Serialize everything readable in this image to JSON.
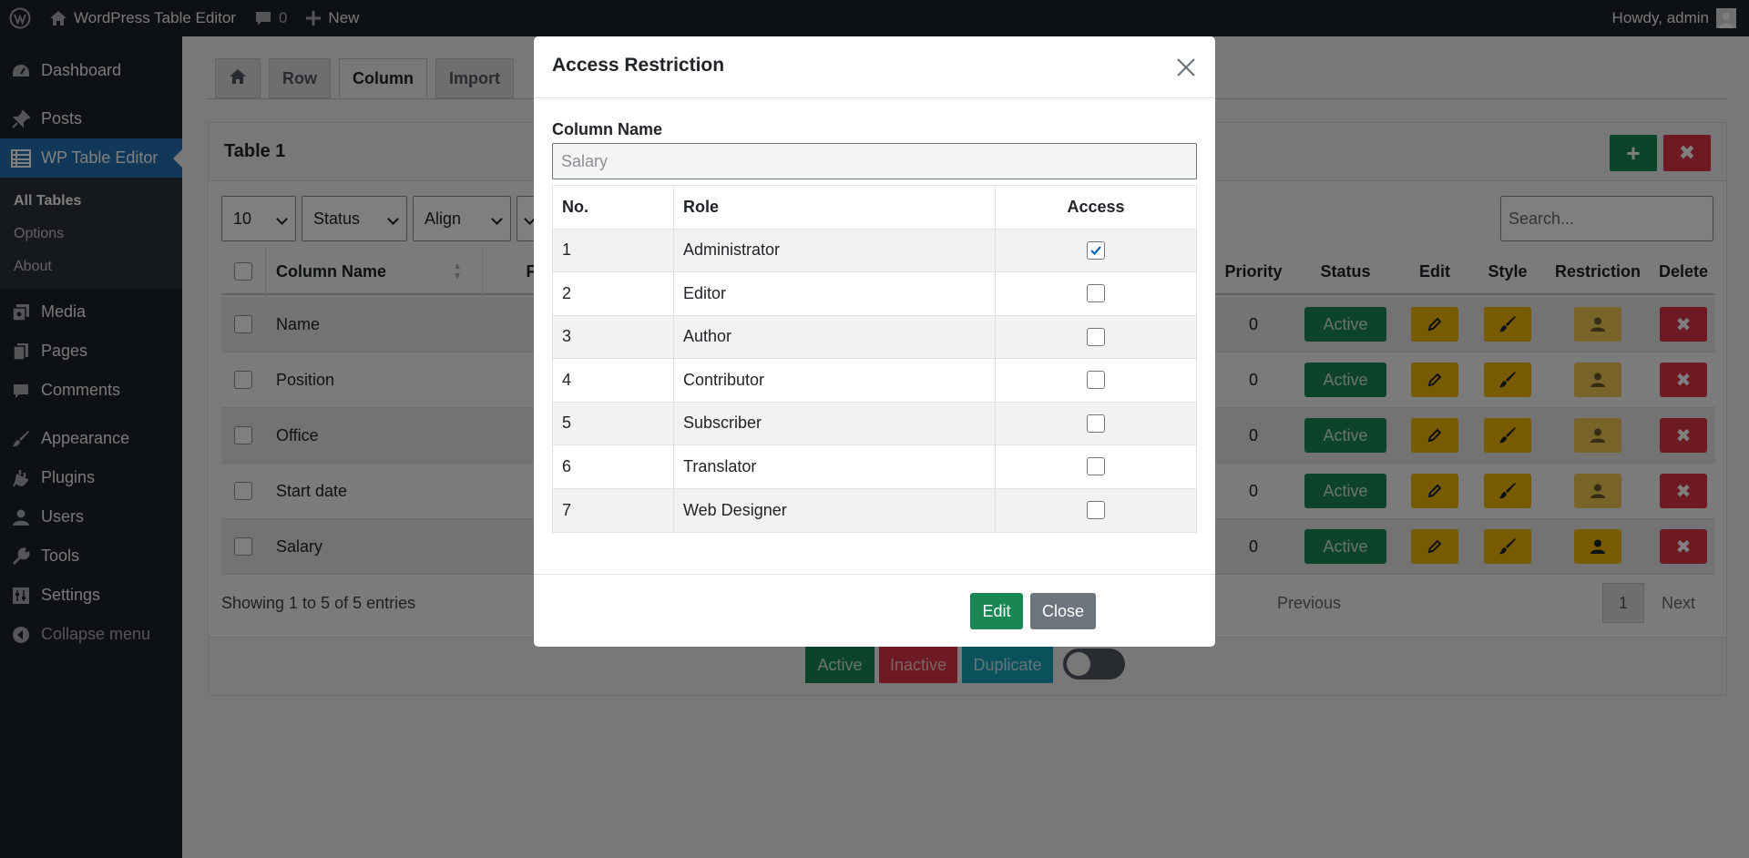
{
  "adminbar": {
    "site_name": "WordPress Table Editor",
    "comments_count": "0",
    "new_label": "New",
    "howdy": "Howdy, admin"
  },
  "sidebar": {
    "dashboard": "Dashboard",
    "posts": "Posts",
    "wp_table_editor": "WP Table Editor",
    "sub": [
      "All Tables",
      "Options",
      "About"
    ],
    "media": "Media",
    "pages": "Pages",
    "comments": "Comments",
    "appearance": "Appearance",
    "plugins": "Plugins",
    "users": "Users",
    "tools": "Tools",
    "settings": "Settings",
    "collapse": "Collapse menu"
  },
  "tabs": [
    "Row",
    "Column",
    "Import"
  ],
  "panel": {
    "title": "Table 1",
    "add_symbol": "+",
    "delete_symbol": "✖",
    "filters": [
      "10",
      "Status",
      "Align"
    ],
    "search_placeholder": "Search...",
    "headers": {
      "column_name": "Column Name",
      "f": "F",
      "priority": "Priority",
      "status": "Status",
      "edit": "Edit",
      "style": "Style",
      "restriction": "Restriction",
      "delete": "Delete"
    },
    "rows": [
      {
        "name": "Name",
        "priority": "0",
        "status": "Active"
      },
      {
        "name": "Position",
        "priority": "0",
        "status": "Active"
      },
      {
        "name": "Office",
        "priority": "0",
        "status": "Active"
      },
      {
        "name": "Start date",
        "priority": "0",
        "status": "Active"
      },
      {
        "name": "Salary",
        "priority": "0",
        "status": "Active"
      }
    ],
    "showing": "Showing 1 to 5 of 5 entries",
    "pager": {
      "previous": "Previous",
      "page": "1",
      "next": "Next"
    },
    "footer": {
      "active": "Active",
      "inactive": "Inactive",
      "duplicate": "Duplicate"
    }
  },
  "modal": {
    "title": "Access Restriction",
    "column_label": "Column Name",
    "column_placeholder": "Salary",
    "table_headers": {
      "no": "No.",
      "role": "Role",
      "access": "Access"
    },
    "roles": [
      {
        "no": "1",
        "role": "Administrator",
        "checked": true
      },
      {
        "no": "2",
        "role": "Editor",
        "checked": false
      },
      {
        "no": "3",
        "role": "Author",
        "checked": false
      },
      {
        "no": "4",
        "role": "Contributor",
        "checked": false
      },
      {
        "no": "5",
        "role": "Subscriber",
        "checked": false
      },
      {
        "no": "6",
        "role": "Translator",
        "checked": false
      },
      {
        "no": "7",
        "role": "Web Designer",
        "checked": false
      }
    ],
    "edit_label": "Edit",
    "close_label": "Close"
  },
  "colors": {
    "success": "#198754",
    "danger": "#dc3545",
    "warning": "#f0b400",
    "info": "#17a2b8",
    "secondary": "#6c757d",
    "wp_blue": "#2271b1"
  }
}
